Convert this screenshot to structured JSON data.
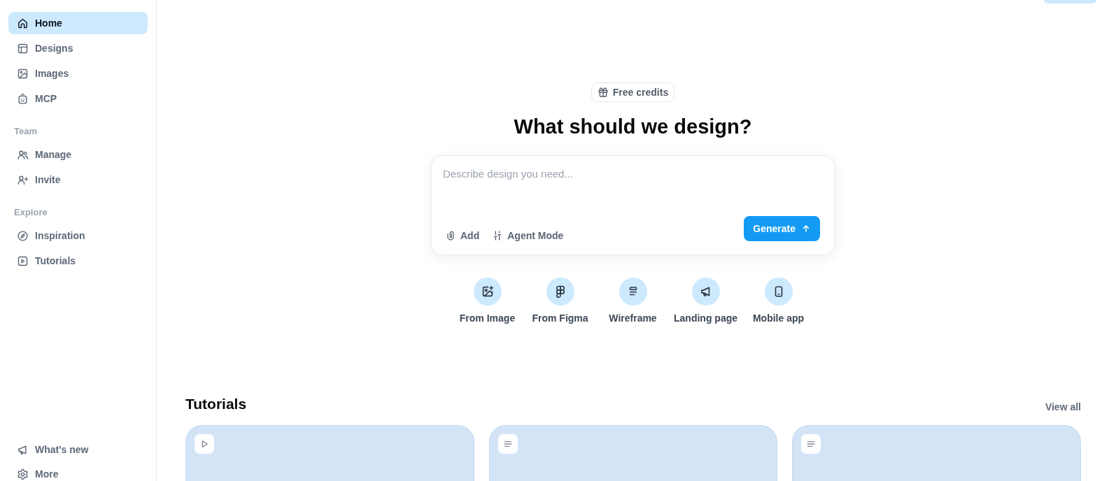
{
  "sidebar": {
    "items": [
      {
        "label": "Home",
        "selected": true
      },
      {
        "label": "Designs",
        "selected": false
      },
      {
        "label": "Images",
        "selected": false
      },
      {
        "label": "MCP",
        "selected": false
      }
    ],
    "sections": [
      {
        "title": "Team",
        "items": [
          {
            "label": "Manage",
            "selected": false
          },
          {
            "label": "Invite",
            "selected": false
          }
        ]
      },
      {
        "title": "Explore",
        "items": [
          {
            "label": "Inspiration",
            "selected": false
          },
          {
            "label": "Tutorials",
            "selected": false
          }
        ]
      }
    ],
    "footer_items": [
      {
        "label": "What's new",
        "selected": false
      },
      {
        "label": "More",
        "selected": false
      }
    ]
  },
  "hero": {
    "badge": "Free credits",
    "title": "What should we design?",
    "prompt": {
      "placeholder": "Describe design you need...",
      "tools": [
        "Add",
        "Agent Mode"
      ],
      "submit": "Generate"
    },
    "shortcuts": [
      "From Image",
      "From Figma",
      "Wireframe",
      "Landing page",
      "Mobile app"
    ]
  },
  "tutorials": {
    "title": "Tutorials",
    "link": "View all",
    "cards": [
      {
        "kind": "video"
      },
      {
        "kind": "article"
      },
      {
        "kind": "article"
      }
    ]
  }
}
